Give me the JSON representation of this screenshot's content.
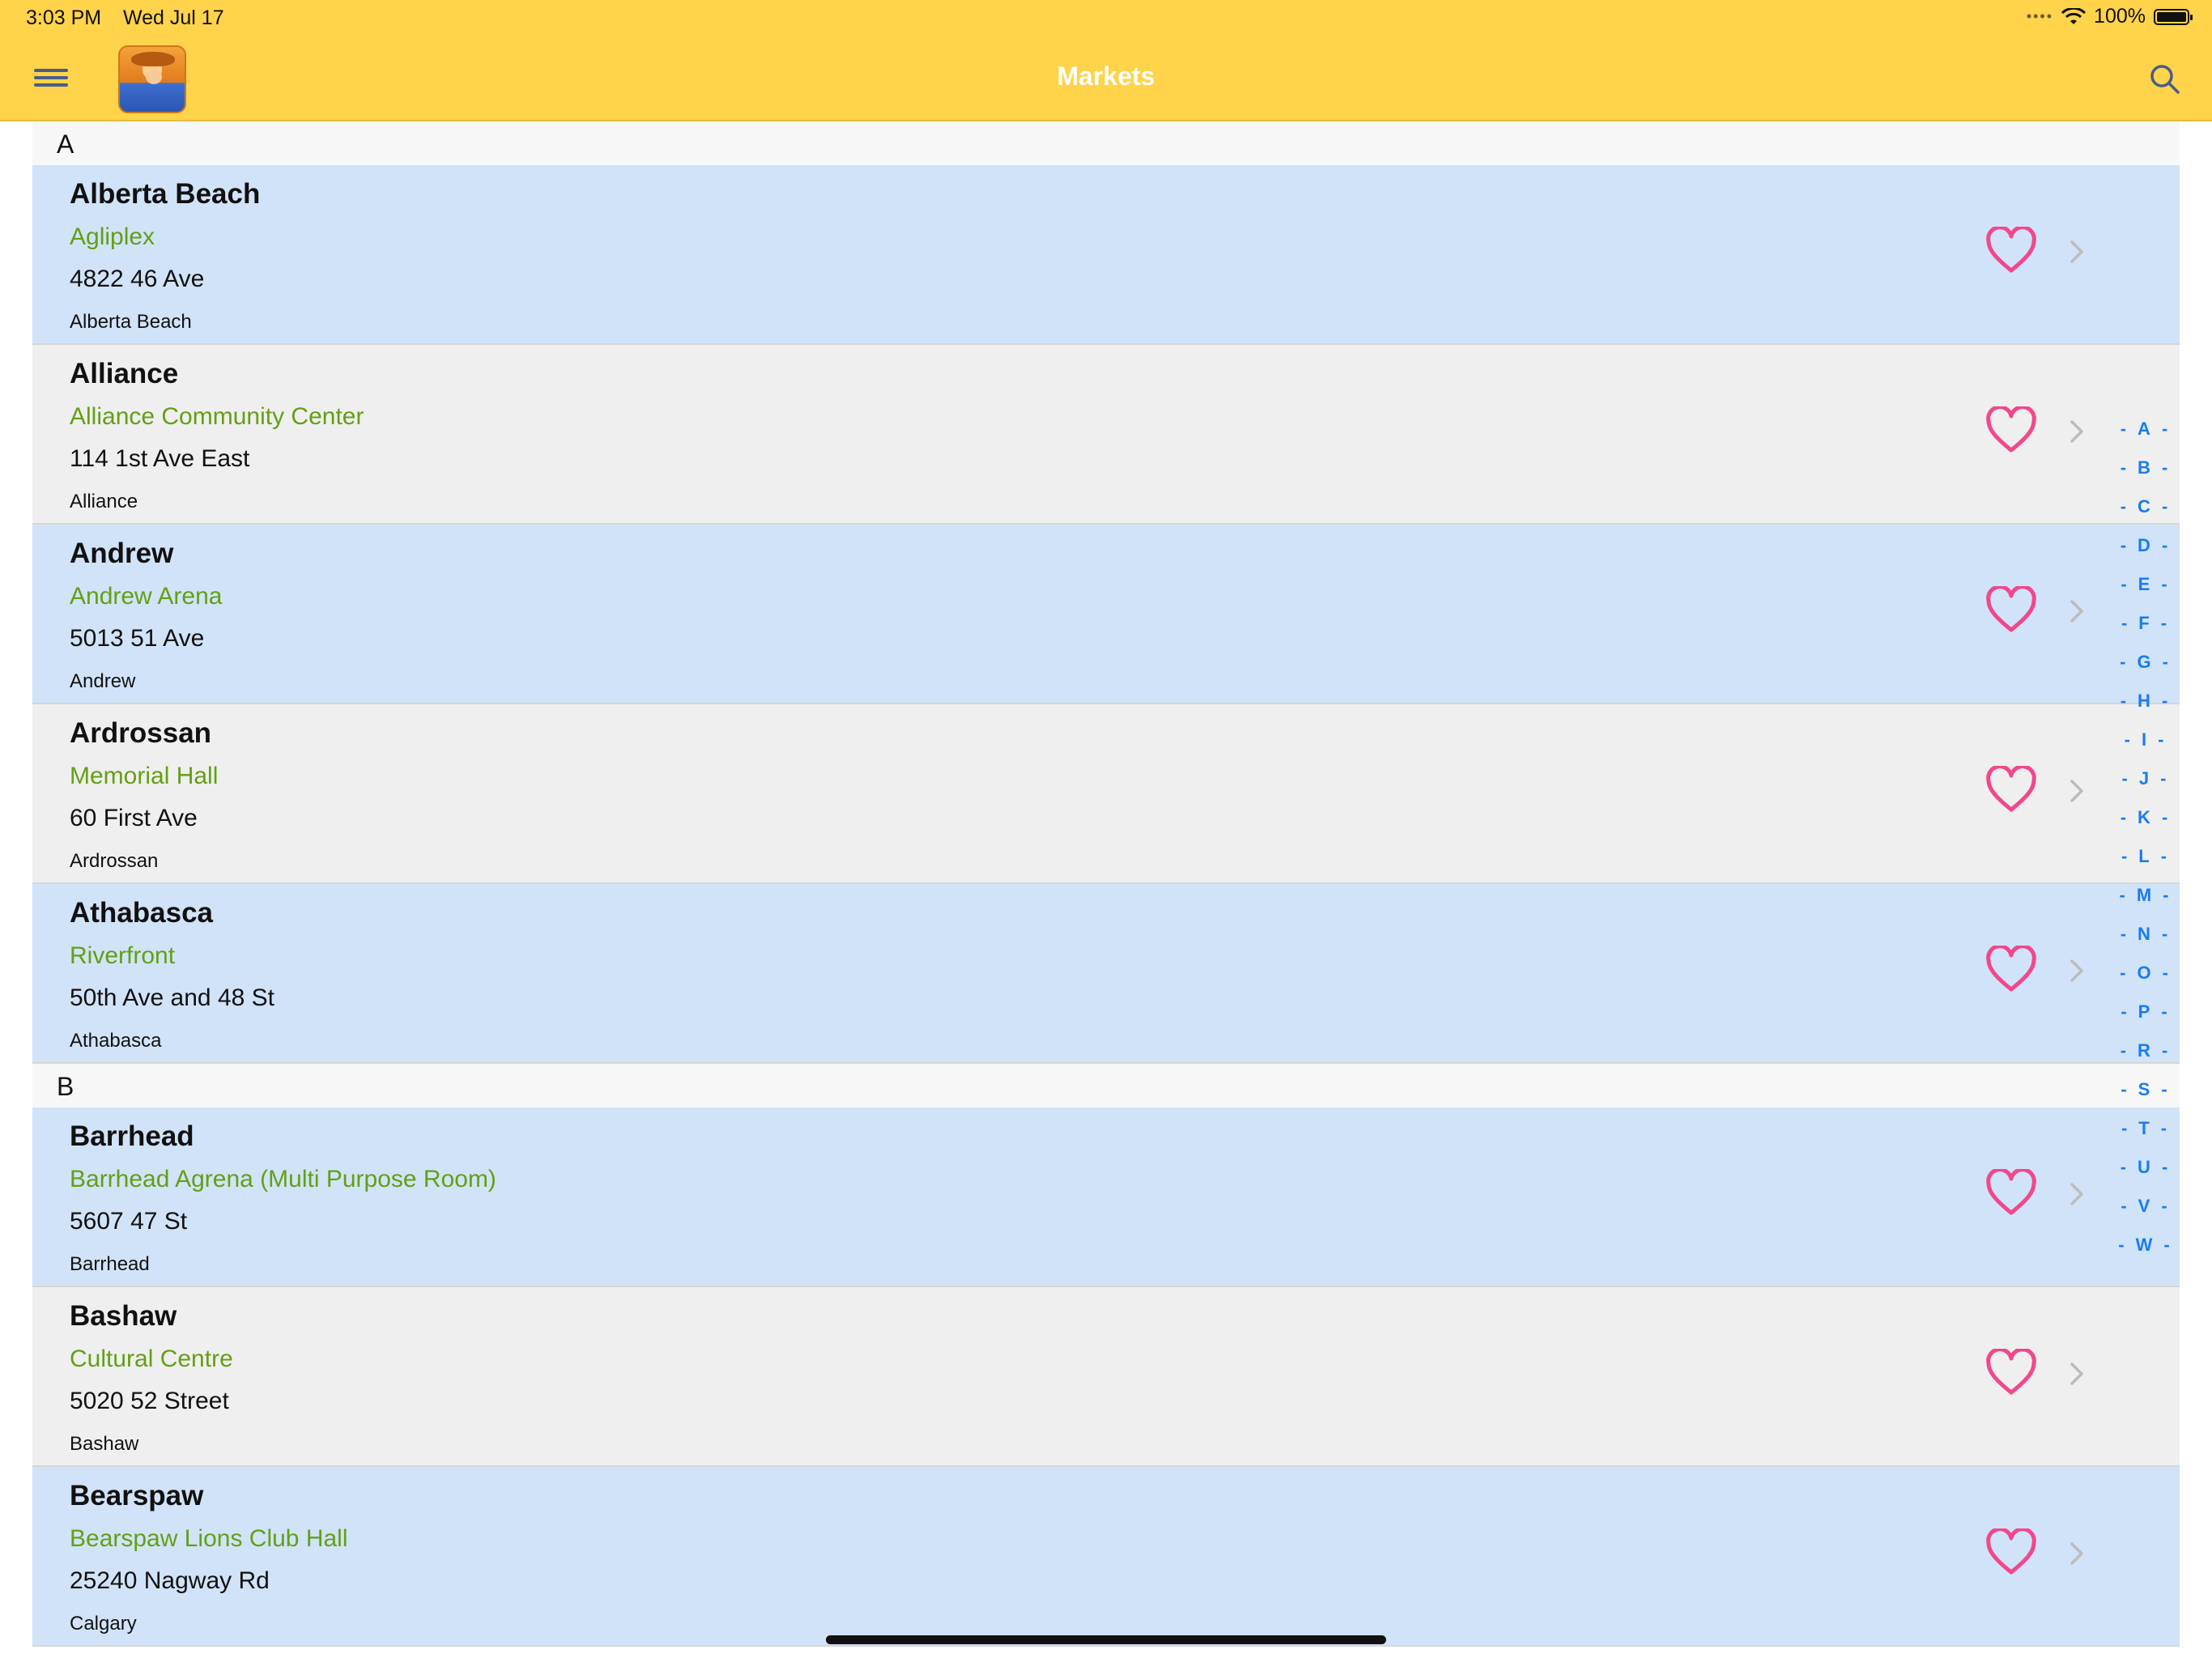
{
  "status_bar": {
    "time": "3:03 PM",
    "date": "Wed Jul 17",
    "battery": "100%"
  },
  "header": {
    "title": "Markets"
  },
  "sections": [
    {
      "letter": "A",
      "rows": [
        {
          "name": "Alberta Beach",
          "venue": "Agliplex",
          "address": "4822 46 Ave",
          "city": "Alberta Beach"
        },
        {
          "name": "Alliance",
          "venue": "Alliance Community Center",
          "address": "114 1st Ave East",
          "city": "Alliance"
        },
        {
          "name": "Andrew",
          "venue": "Andrew Arena",
          "address": "5013 51 Ave",
          "city": "Andrew"
        },
        {
          "name": "Ardrossan",
          "venue": "Memorial Hall",
          "address": "60 First Ave",
          "city": "Ardrossan"
        },
        {
          "name": "Athabasca",
          "venue": "Riverfront",
          "address": "50th Ave and 48 St",
          "city": "Athabasca"
        }
      ]
    },
    {
      "letter": "B",
      "rows": [
        {
          "name": "Barrhead",
          "venue": "Barrhead Agrena (Multi Purpose Room)",
          "address": "5607 47 St",
          "city": "Barrhead"
        },
        {
          "name": "Bashaw",
          "venue": "Cultural Centre",
          "address": "5020 52 Street",
          "city": "Bashaw"
        },
        {
          "name": "Bearspaw",
          "venue": "Bearspaw Lions Club Hall",
          "address": "25240 Nagway Rd",
          "city": "Calgary"
        }
      ]
    }
  ],
  "index": [
    "A",
    "B",
    "C",
    "D",
    "E",
    "F",
    "G",
    "H",
    "I",
    "J",
    "K",
    "L",
    "M",
    "N",
    "O",
    "P",
    "R",
    "S",
    "T",
    "U",
    "V",
    "W"
  ],
  "colors": {
    "header_bg": "#FFD34A",
    "row_blue": "#D1E3F9",
    "row_gray": "#EFEFEF",
    "venue_green": "#63A013",
    "heart_pink": "#F2478C",
    "index_blue": "#1A7CF0"
  },
  "icons": {
    "menu": "hamburger-menu-icon",
    "search": "search-icon",
    "favorite": "heart-outline-icon",
    "chevron": "chevron-right-icon"
  }
}
